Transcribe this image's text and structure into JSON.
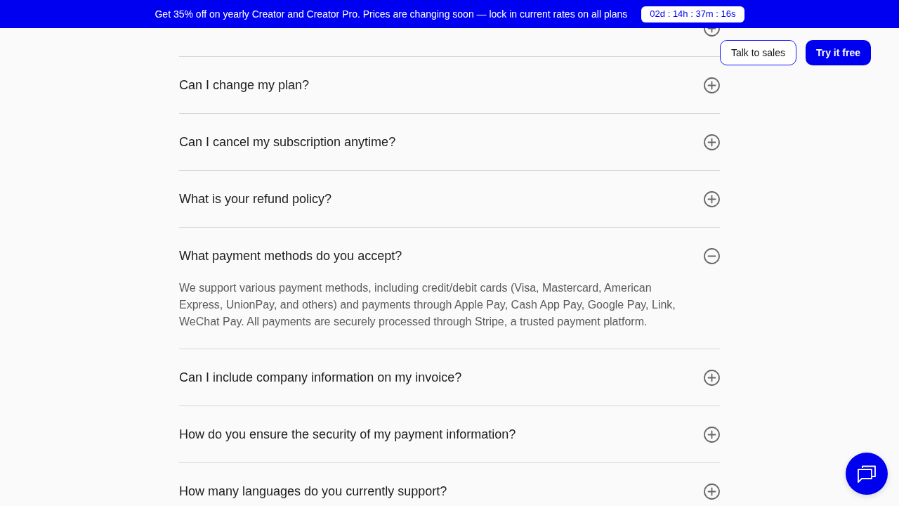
{
  "banner": {
    "text": "Get 35% off on yearly Creator and Creator Pro. Prices are changing soon — lock in current rates on all plans",
    "countdown": "02d : 14h : 37m : 16s"
  },
  "nav": {
    "buttons": [
      {
        "label": "Talk to sales",
        "kind": "outline"
      },
      {
        "label": "Try it free",
        "kind": "primary"
      }
    ]
  },
  "faq": [
    {
      "expanded": false
    },
    {
      "question": "Can I change my plan?",
      "expanded": false
    },
    {
      "question": "Can I cancel my subscription anytime?",
      "expanded": false
    },
    {
      "question": "What is your refund policy?",
      "expanded": false
    },
    {
      "question": "What payment methods do you accept?",
      "expanded": true,
      "answer": "We support various payment methods, including credit/debit cards (Visa, Mastercard, American Express, UnionPay, and others) and payments through Apple Pay, Cash App Pay, Google Pay, Link, WeChat Pay. All payments are securely processed through Stripe, a trusted payment platform."
    },
    {
      "question": "Can I include company information on my invoice?",
      "expanded": false
    },
    {
      "question": "How do you ensure the security of my payment information?",
      "expanded": false
    },
    {
      "question": "How many languages do you currently support?",
      "expanded": false
    }
  ]
}
